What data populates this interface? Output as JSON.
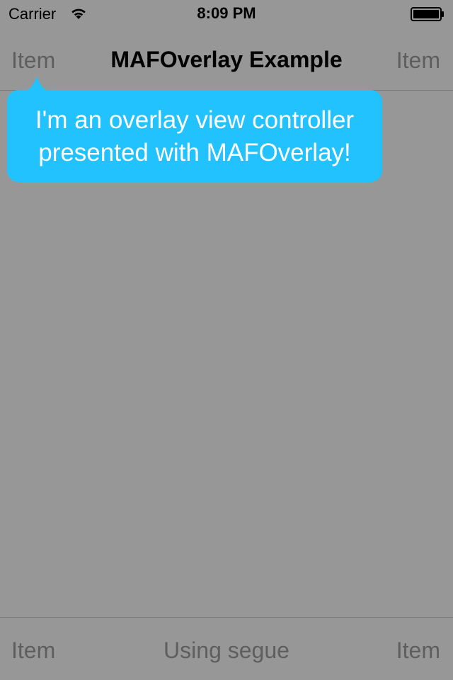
{
  "status_bar": {
    "carrier": "Carrier",
    "time": "8:09 PM",
    "wifi_icon": "wifi-icon",
    "battery_icon": "battery-icon"
  },
  "nav_bar": {
    "left_item": "Item",
    "title": "MAFOverlay Example",
    "right_item": "Item"
  },
  "overlay": {
    "message": "I'm an overlay view controller presented with MAFOverlay!",
    "background_color": "#22c2ff"
  },
  "toolbar": {
    "left_item": "Item",
    "center_item": "Using segue",
    "right_item": "Item"
  },
  "colors": {
    "dimmed_background": "#979797",
    "dimmed_text": "#5e5e5e",
    "bubble": "#22c2ff"
  }
}
